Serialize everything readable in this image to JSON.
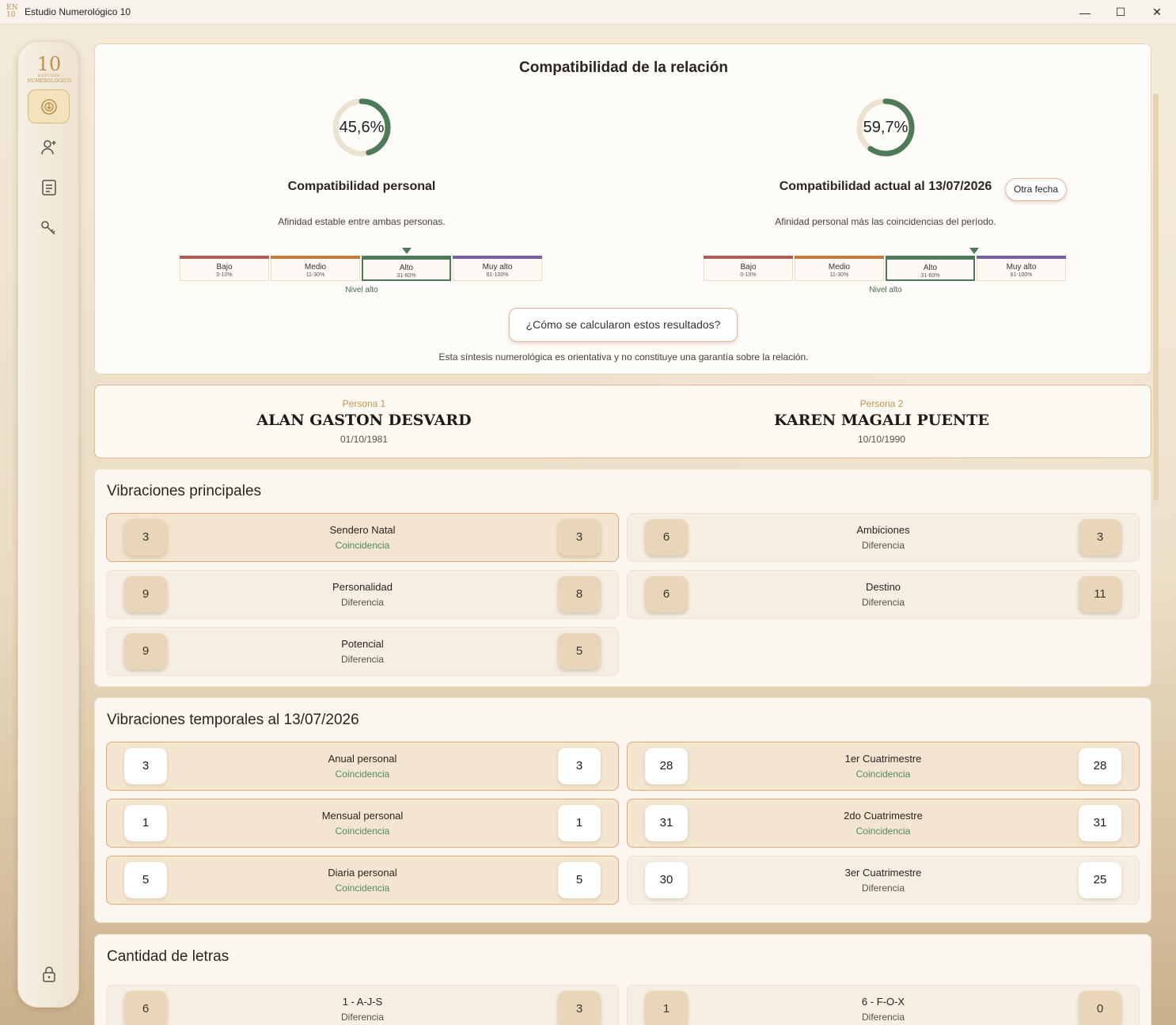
{
  "window": {
    "title": "Estudio Numerológico 10",
    "icon_text": "EN 10",
    "minimize": "—",
    "maximize": "☐",
    "close": "✕"
  },
  "sidebar": {
    "logo": {
      "number": "10",
      "line1": "ESTUDIO",
      "line2": "NUMEROLÓGICO"
    },
    "items": [
      {
        "name": "compatibility-icon",
        "active": true
      },
      {
        "name": "person-add-icon",
        "active": false
      },
      {
        "name": "document-icon",
        "active": false
      },
      {
        "name": "key-icon",
        "active": false
      }
    ],
    "lock": "lock-icon"
  },
  "compat": {
    "title": "Compatibilidad de la relación",
    "personal": {
      "percent": 45.6,
      "percent_label": "45,6%",
      "label": "Compatibilidad personal",
      "desc": "Afinidad estable entre ambas personas.",
      "level": "Nivel alto",
      "selected": 2
    },
    "current": {
      "percent": 59.7,
      "percent_label": "59,7%",
      "label": "Compatibilidad actual al 13/07/2026",
      "desc": "Afinidad personal más las coincidencias del período.",
      "level": "Nivel alto",
      "selected": 2,
      "button": "Otra fecha"
    },
    "scale": [
      {
        "name": "Bajo",
        "range": "0-10%",
        "color": "#b65a56"
      },
      {
        "name": "Medio",
        "range": "11-30%",
        "color": "#c97a3a"
      },
      {
        "name": "Alto",
        "range": "31-60%",
        "color": "#4e7a59"
      },
      {
        "name": "Muy alto",
        "range": "61-100%",
        "color": "#7a5fa0"
      }
    ],
    "how_button": "¿Cómo se calcularon estos resultados?",
    "disclaimer": "Esta síntesis numerológica es orientativa y no constituye una garantía sobre la relación.",
    "colors": {
      "ring_fill": "#4e7a59",
      "ring_track": "#ece2d0"
    }
  },
  "persons": [
    {
      "tag": "Persona 1",
      "name": "ALAN GASTON DESVARD",
      "date": "01/10/1981"
    },
    {
      "tag": "Persona 2",
      "name": "KAREN MAGALI PUENTE",
      "date": "10/10/1990"
    }
  ],
  "principales": {
    "title": "Vibraciones principales",
    "rows": [
      {
        "label": "Sendero Natal",
        "status": "Coincidencia",
        "a": "3",
        "b": "3",
        "match": true
      },
      {
        "label": "Ambiciones",
        "status": "Diferencia",
        "a": "6",
        "b": "3",
        "match": false
      },
      {
        "label": "Personalidad",
        "status": "Diferencia",
        "a": "9",
        "b": "8",
        "match": false
      },
      {
        "label": "Destino",
        "status": "Diferencia",
        "a": "6",
        "b": "11",
        "match": false
      },
      {
        "label": "Potencial",
        "status": "Diferencia",
        "a": "9",
        "b": "5",
        "match": false
      }
    ]
  },
  "temporales": {
    "title": "Vibraciones temporales al 13/07/2026",
    "rows": [
      {
        "label": "Anual personal",
        "status": "Coincidencia",
        "a": "3",
        "b": "3",
        "match": true
      },
      {
        "label": "1er Cuatrimestre",
        "status": "Coincidencia",
        "a": "28",
        "b": "28",
        "match": true
      },
      {
        "label": "Mensual personal",
        "status": "Coincidencia",
        "a": "1",
        "b": "1",
        "match": true
      },
      {
        "label": "2do Cuatrimestre",
        "status": "Coincidencia",
        "a": "31",
        "b": "31",
        "match": true
      },
      {
        "label": "Diaria personal",
        "status": "Coincidencia",
        "a": "5",
        "b": "5",
        "match": true
      },
      {
        "label": "3er Cuatrimestre",
        "status": "Diferencia",
        "a": "30",
        "b": "25",
        "match": false
      }
    ]
  },
  "letras": {
    "title": "Cantidad de letras",
    "rows": [
      {
        "label": "1 - A-J-S",
        "status": "Diferencia",
        "a": "6",
        "b": "3",
        "match": false
      },
      {
        "label": "6 - F-O-X",
        "status": "Diferencia",
        "a": "1",
        "b": "0",
        "match": false
      }
    ]
  }
}
